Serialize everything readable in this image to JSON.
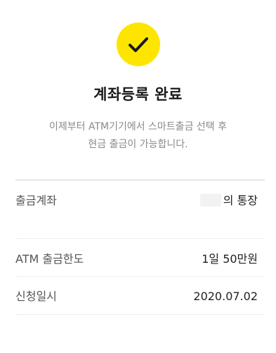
{
  "status": {
    "icon": "checkmark-icon",
    "accent_color": "#FEE500",
    "title": "계좌등록 완료",
    "description_line1": "이제부터 ATM기기에서 스마트출금 선택 후",
    "description_line2": "현금 출금이 가능합니다."
  },
  "details": [
    {
      "label": "출금계좌",
      "value": "의 통장"
    },
    {
      "label": "ATM 출금한도",
      "value": "1일 50만원"
    },
    {
      "label": "신청일시",
      "value": "2020.07.02"
    }
  ]
}
